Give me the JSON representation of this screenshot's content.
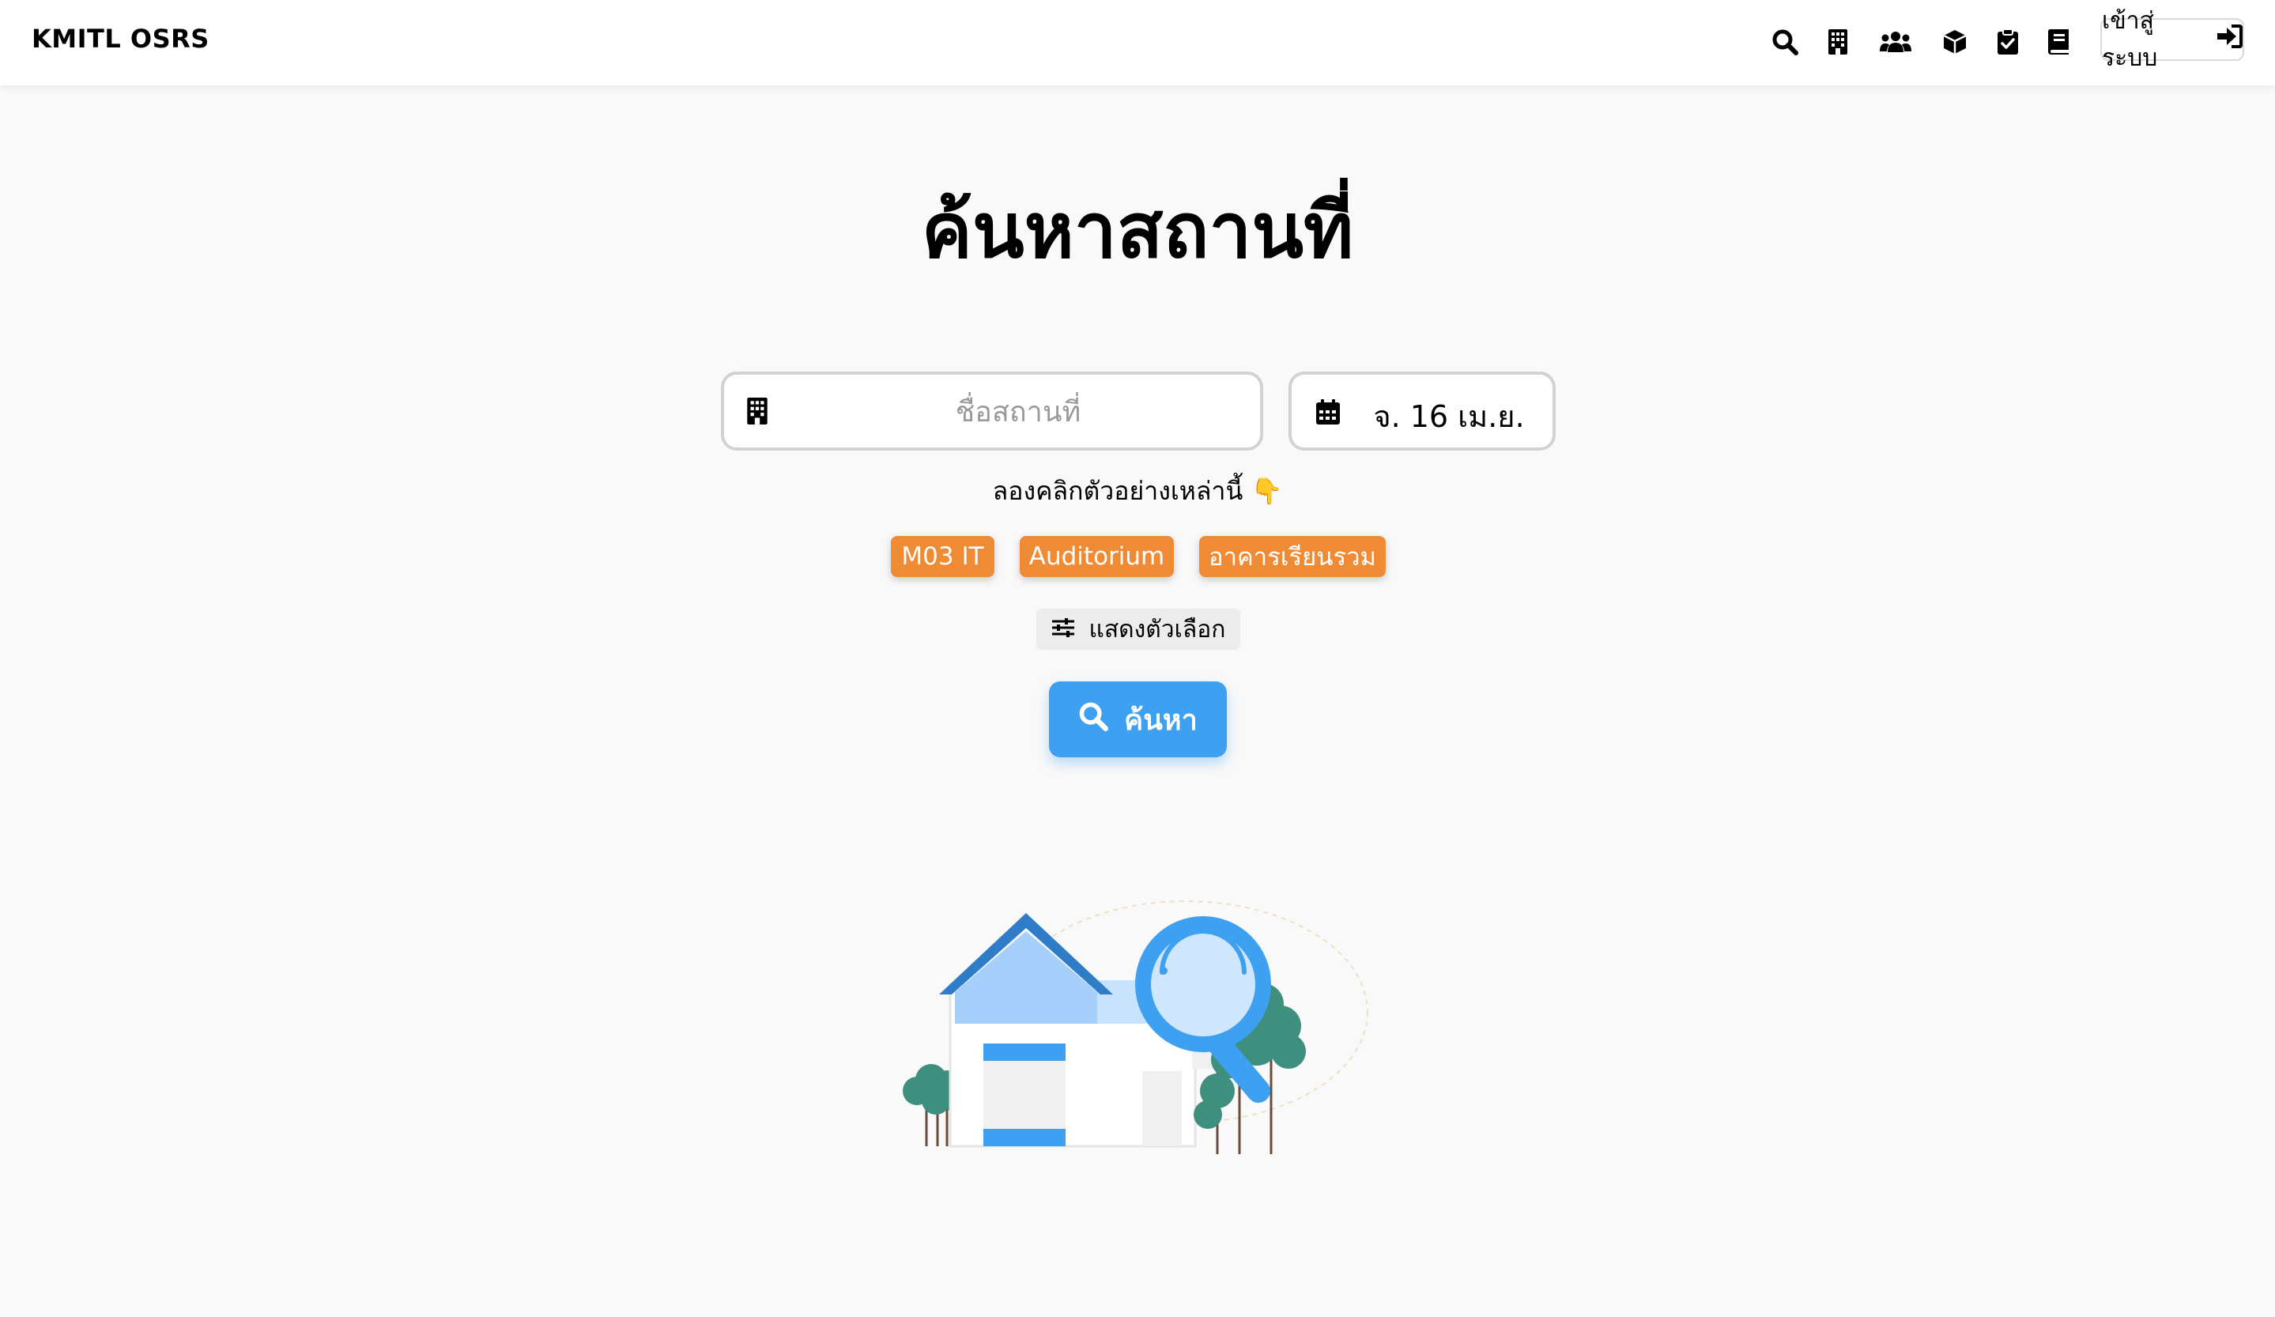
{
  "app": {
    "brand": "KMITL OSRS"
  },
  "nav": {
    "icons": [
      "search-icon",
      "building-icon",
      "users-icon",
      "box-icon",
      "clipboard-check-icon",
      "book-icon"
    ],
    "login_label": "เข้าสู่ระบบ"
  },
  "main": {
    "title": "ค้นหาสถานที่",
    "place_placeholder": "ชื่อสถานที่",
    "place_value": "",
    "date_value": "จ. 16 เม.ย.",
    "hint": "ลองคลิกตัวอย่างเหล่านี้ 👇",
    "examples": [
      "M03 IT",
      "Auditorium",
      "อาคารเรียนรวม"
    ],
    "options_label": "แสดงตัวเลือก",
    "search_label": "ค้นหา"
  },
  "colors": {
    "accent": "#3ea0f1",
    "chip": "#ef8a35",
    "background": "#f9f9f9"
  }
}
